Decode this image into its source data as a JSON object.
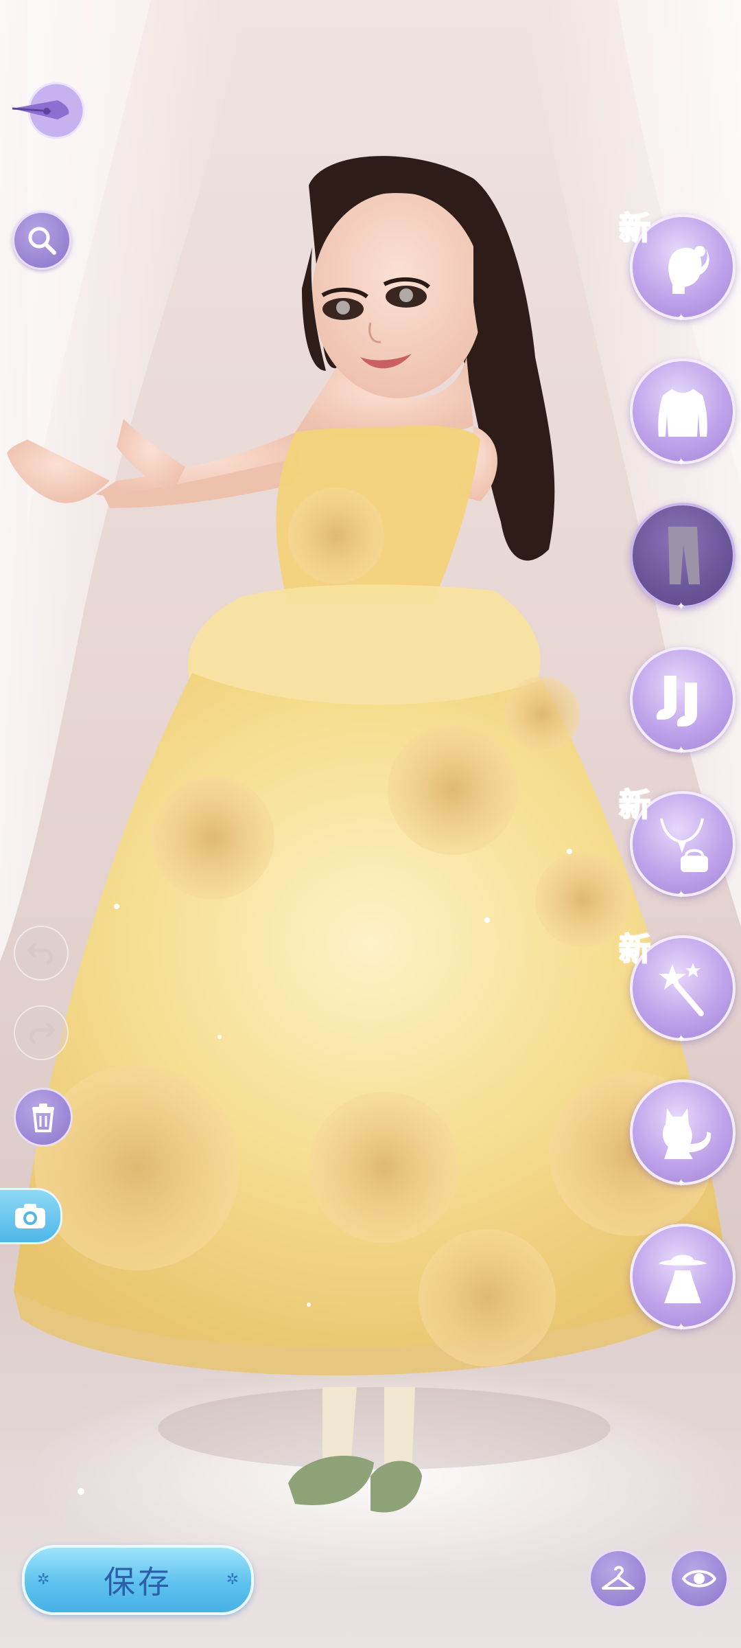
{
  "colors": {
    "accent_purple": "#a184d8",
    "save_blue": "#5ec2ee",
    "new_tag": "#d23fb9",
    "dress_gold": "#f5d77c"
  },
  "left_toolbar": [
    {
      "id": "back",
      "icon": "quill-pen-icon"
    },
    {
      "id": "search",
      "icon": "search-icon"
    },
    {
      "id": "undo",
      "icon": "undo-arrow-icon"
    },
    {
      "id": "redo",
      "icon": "redo-arrow-icon"
    },
    {
      "id": "delete",
      "icon": "trash-icon"
    },
    {
      "id": "camera",
      "icon": "camera-icon"
    }
  ],
  "categories": [
    {
      "id": "hair",
      "icon": "hairstyle-icon",
      "new_label": "新",
      "active": false
    },
    {
      "id": "top",
      "icon": "top-icon",
      "new_label": "",
      "active": false
    },
    {
      "id": "bottom",
      "icon": "pants-icon",
      "new_label": "",
      "active": true
    },
    {
      "id": "shoes",
      "icon": "socks-icon",
      "new_label": "",
      "active": false
    },
    {
      "id": "accessory",
      "icon": "necklace-bag-icon",
      "new_label": "新",
      "active": false
    },
    {
      "id": "handheld",
      "icon": "magic-wand-icon",
      "new_label": "新",
      "active": false
    },
    {
      "id": "pet",
      "icon": "cat-icon",
      "new_label": "",
      "active": false
    },
    {
      "id": "outfit",
      "icon": "hat-dress-icon",
      "new_label": "",
      "active": false
    }
  ],
  "bottom_bar": {
    "save_label": "保存",
    "hanger_icon": "hanger-icon",
    "eye_icon": "eye-icon"
  }
}
